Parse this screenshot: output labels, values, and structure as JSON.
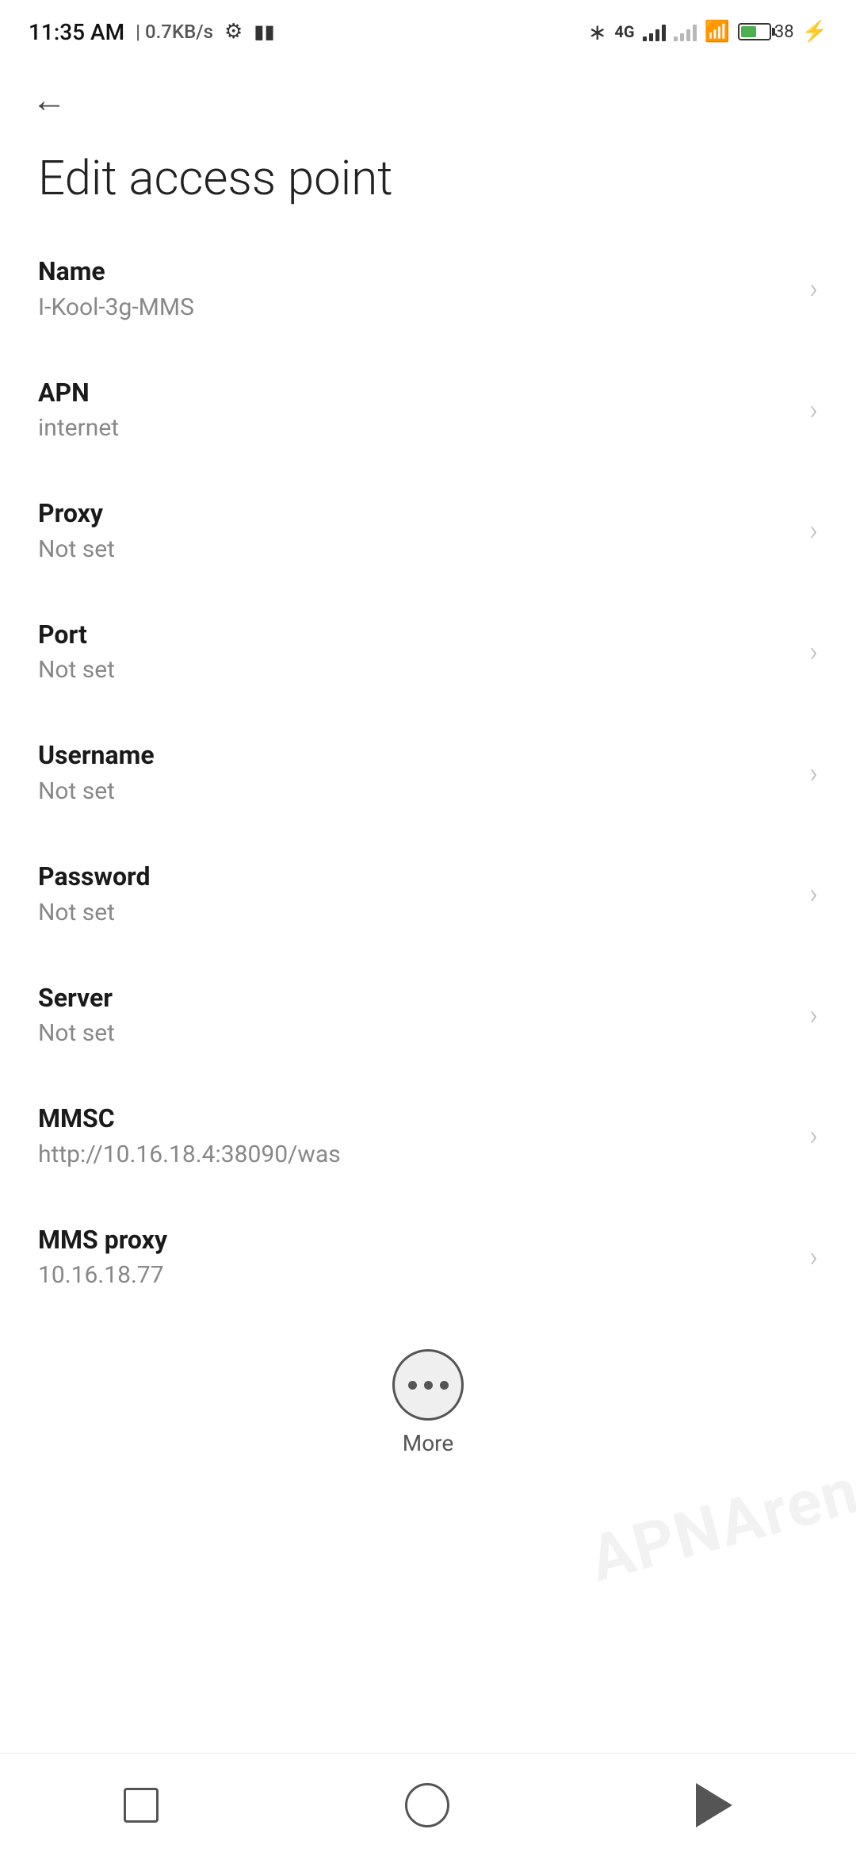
{
  "status_bar": {
    "time": "11:35 AM",
    "speed": "0.7KB/s",
    "battery_pct": "38"
  },
  "toolbar": {
    "back_label": "←"
  },
  "page": {
    "title": "Edit access point"
  },
  "settings_items": [
    {
      "id": "name",
      "label": "Name",
      "value": "I-Kool-3g-MMS"
    },
    {
      "id": "apn",
      "label": "APN",
      "value": "internet"
    },
    {
      "id": "proxy",
      "label": "Proxy",
      "value": "Not set"
    },
    {
      "id": "port",
      "label": "Port",
      "value": "Not set"
    },
    {
      "id": "username",
      "label": "Username",
      "value": "Not set"
    },
    {
      "id": "password",
      "label": "Password",
      "value": "Not set"
    },
    {
      "id": "server",
      "label": "Server",
      "value": "Not set"
    },
    {
      "id": "mmsc",
      "label": "MMSC",
      "value": "http://10.16.18.4:38090/was"
    },
    {
      "id": "mms-proxy",
      "label": "MMS proxy",
      "value": "10.16.18.77"
    }
  ],
  "more_button": {
    "label": "More"
  },
  "watermark": {
    "text": "APNArena"
  },
  "nav_bar": {
    "square_label": "recent",
    "circle_label": "home",
    "triangle_label": "back"
  }
}
